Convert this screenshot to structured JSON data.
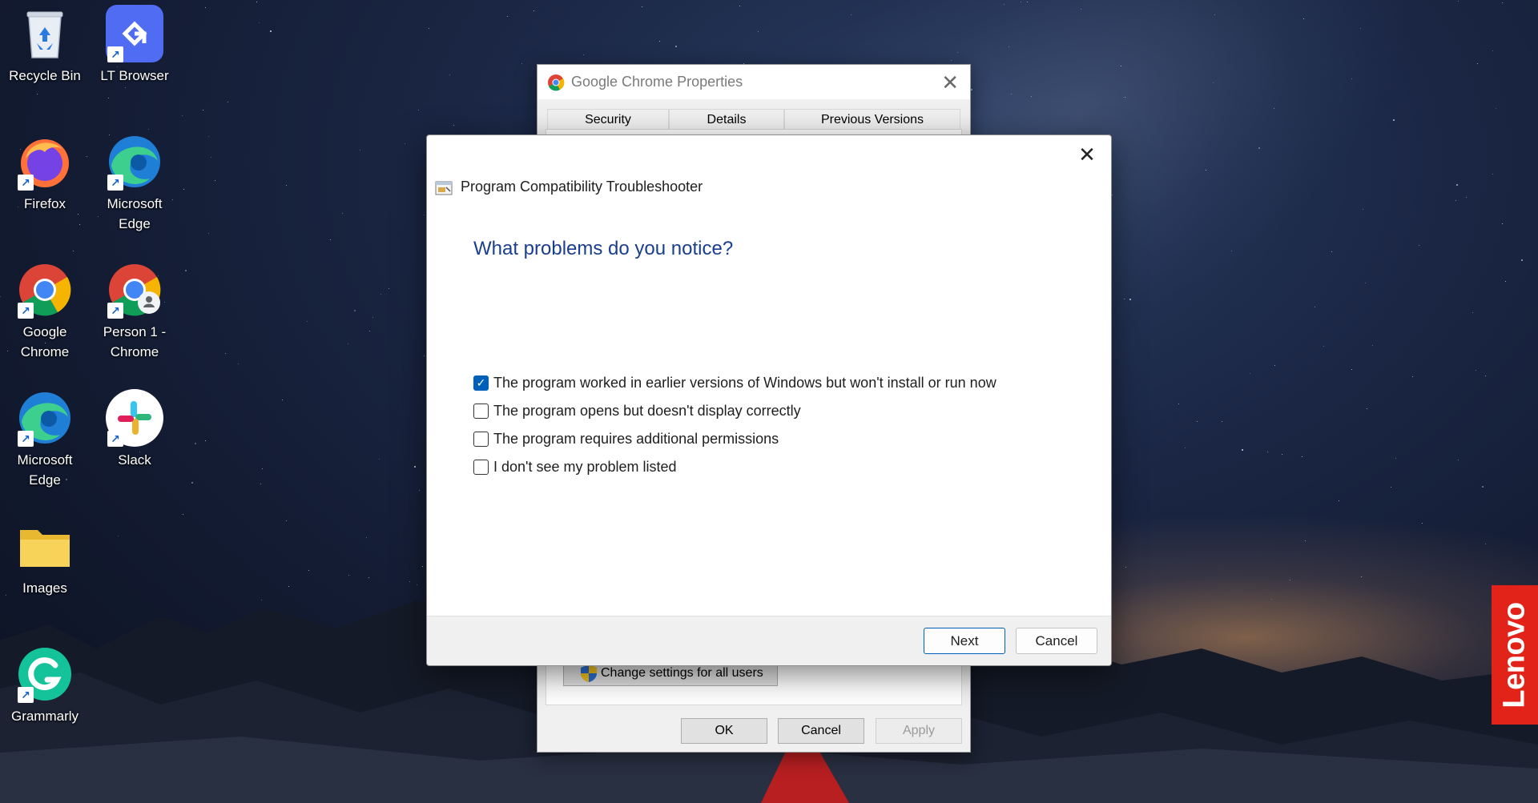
{
  "desktop": {
    "icons": [
      {
        "id": "recycle-bin",
        "label": "Recycle Bin",
        "shortcut": false
      },
      {
        "id": "lt-browser",
        "label": "LT Browser",
        "shortcut": true
      },
      {
        "id": "firefox",
        "label": "Firefox",
        "shortcut": true
      },
      {
        "id": "microsoft-edge",
        "label": "Microsoft Edge",
        "shortcut": true
      },
      {
        "id": "google-chrome",
        "label": "Google Chrome",
        "shortcut": true
      },
      {
        "id": "person1-chrome",
        "label": "Person 1 - Chrome",
        "shortcut": true
      },
      {
        "id": "microsoft-edge-2",
        "label": "Microsoft Edge",
        "shortcut": true
      },
      {
        "id": "slack",
        "label": "Slack",
        "shortcut": true
      },
      {
        "id": "images",
        "label": "Images",
        "shortcut": false
      },
      {
        "id": "grammarly",
        "label": "Grammarly",
        "shortcut": true
      }
    ],
    "brand_badge": "Lenovo",
    "brand_color": "#e2231a"
  },
  "properties_window": {
    "title": "Google Chrome Properties",
    "tabs": [
      "Security",
      "Details",
      "Previous Versions"
    ],
    "change_settings_label": "Change settings for all users",
    "buttons": {
      "ok": "OK",
      "cancel": "Cancel",
      "apply": "Apply"
    },
    "apply_enabled": false
  },
  "troubleshooter": {
    "title": "Program Compatibility Troubleshooter",
    "heading": "What problems do you notice?",
    "options": [
      {
        "label": "The program worked in earlier versions of Windows but won't install or run now",
        "checked": true
      },
      {
        "label": "The program opens but doesn't display correctly",
        "checked": false
      },
      {
        "label": "The program requires additional permissions",
        "checked": false
      },
      {
        "label": "I don't see my problem listed",
        "checked": false
      }
    ],
    "buttons": {
      "next": "Next",
      "cancel": "Cancel"
    },
    "accent_color": "#005fb8",
    "heading_color": "#1a3e8f"
  }
}
